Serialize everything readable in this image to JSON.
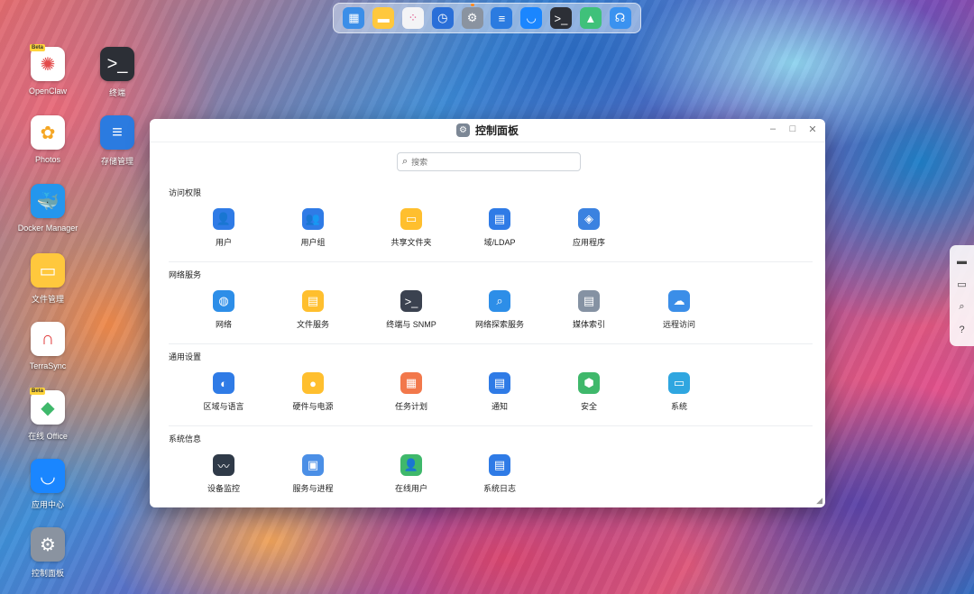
{
  "dock": {
    "items": [
      {
        "name": "dock-app-layout-icon",
        "glyph": "▦",
        "color": "#3b8ee8"
      },
      {
        "name": "dock-notes-icon",
        "glyph": "▬",
        "color": "#ffc83d"
      },
      {
        "name": "dock-app-grid-icon",
        "glyph": "⁘",
        "color": "#f4f4f6"
      },
      {
        "name": "dock-backup-icon",
        "glyph": "◷",
        "color": "#2a6fd8"
      },
      {
        "name": "dock-settings-icon",
        "glyph": "⚙",
        "color": "#8a93a0"
      },
      {
        "name": "dock-storage-icon",
        "glyph": "≡",
        "color": "#2b7be0"
      },
      {
        "name": "dock-app-center-icon",
        "glyph": "◡",
        "color": "#1a86ff"
      },
      {
        "name": "dock-terminal-icon",
        "glyph": ">_",
        "color": "#2c2f36"
      },
      {
        "name": "dock-photos-tree-icon",
        "glyph": "▲",
        "color": "#3fc17a"
      },
      {
        "name": "dock-support-icon",
        "glyph": "☊",
        "color": "#3a92f0"
      }
    ]
  },
  "desktop": {
    "icons": [
      {
        "id": "openclaw",
        "label": "OpenClaw",
        "glyph": "✺",
        "color": "#e34a4a",
        "bg": "#ffffff",
        "beta": "Beta"
      },
      {
        "id": "terminal",
        "label": "终端",
        "glyph": ">_",
        "color": "#ffffff",
        "bg": "#2c2f36",
        "beta": ""
      },
      {
        "id": "photos",
        "label": "Photos",
        "glyph": "✿",
        "color": "#f5a623",
        "bg": "#ffffff",
        "beta": ""
      },
      {
        "id": "storage",
        "label": "存储管理",
        "glyph": "≡",
        "color": "#ffffff",
        "bg": "#2b7be0",
        "beta": ""
      },
      {
        "id": "docker",
        "label": "Docker Manager",
        "glyph": "🐳",
        "color": "#ffffff",
        "bg": "#2496ed",
        "beta": ""
      },
      {
        "id": "files",
        "label": "文件管理",
        "glyph": "▭",
        "color": "#ffffff",
        "bg": "#ffc83d",
        "beta": ""
      },
      {
        "id": "terrasync",
        "label": "TerraSync",
        "glyph": "∩",
        "color": "#e03b3b",
        "bg": "#ffffff",
        "beta": ""
      },
      {
        "id": "office",
        "label": "在线 Office",
        "glyph": "◆",
        "color": "#3fb86b",
        "bg": "#ffffff",
        "beta": "Beta"
      },
      {
        "id": "appcenter",
        "label": "应用中心",
        "glyph": "◡",
        "color": "#ffffff",
        "bg": "#1a86ff",
        "beta": ""
      },
      {
        "id": "controlpanel",
        "label": "控制面板",
        "glyph": "⚙",
        "color": "#ffffff",
        "bg": "#8a93a0",
        "beta": ""
      }
    ]
  },
  "window": {
    "title": "控制面板",
    "controls": {
      "minimize": "–",
      "maximize": "□",
      "close": "✕"
    },
    "search": {
      "placeholder": "搜索",
      "value": ""
    }
  },
  "sections": [
    {
      "title": "访问权限",
      "items": [
        {
          "label": "用户",
          "icon": "user-icon",
          "glyph": "👤",
          "color": "#2f7be6"
        },
        {
          "label": "用户组",
          "icon": "user-group-icon",
          "glyph": "👥",
          "color": "#2f7be6"
        },
        {
          "label": "共享文件夹",
          "icon": "shared-folder-icon",
          "glyph": "▭",
          "color": "#ffbf2e"
        },
        {
          "label": "域/LDAP",
          "icon": "domain-ldap-icon",
          "glyph": "▤",
          "color": "#2f7be6"
        },
        {
          "label": "应用程序",
          "icon": "application-icon",
          "glyph": "◈",
          "color": "#3b82e0"
        }
      ]
    },
    {
      "title": "网络服务",
      "items": [
        {
          "label": "网络",
          "icon": "network-globe-icon",
          "glyph": "◍",
          "color": "#2d8ee8"
        },
        {
          "label": "文件服务",
          "icon": "file-service-icon",
          "glyph": "▤",
          "color": "#ffbf2e"
        },
        {
          "label": "终端与 SNMP",
          "icon": "terminal-snmp-icon",
          "glyph": ">_",
          "color": "#3b4250"
        },
        {
          "label": "网络探索服务",
          "icon": "network-discovery-icon",
          "glyph": "⌕",
          "color": "#2d8ee8"
        },
        {
          "label": "媒体索引",
          "icon": "media-index-icon",
          "glyph": "▤",
          "color": "#8592a3"
        },
        {
          "label": "远程访问",
          "icon": "remote-access-cloud-icon",
          "glyph": "☁",
          "color": "#3b8ee8"
        }
      ]
    },
    {
      "title": "通用设置",
      "items": [
        {
          "label": "区域与语言",
          "icon": "region-language-icon",
          "glyph": "◐",
          "color": "#2f7be6"
        },
        {
          "label": "硬件与电源",
          "icon": "hardware-power-bulb-icon",
          "glyph": "●",
          "color": "#ffbf2e"
        },
        {
          "label": "任务计划",
          "icon": "task-schedule-calendar-icon",
          "glyph": "▦",
          "color": "#f2784b"
        },
        {
          "label": "通知",
          "icon": "notification-icon",
          "glyph": "▤",
          "color": "#2f7be6"
        },
        {
          "label": "安全",
          "icon": "security-shield-icon",
          "glyph": "⬢",
          "color": "#3fb86b"
        },
        {
          "label": "系统",
          "icon": "system-monitor-icon",
          "glyph": "▭",
          "color": "#2fa6e0"
        }
      ]
    },
    {
      "title": "系统信息",
      "items": [
        {
          "label": "设备监控",
          "icon": "device-monitor-icon",
          "glyph": "〰",
          "color": "#2f3a48"
        },
        {
          "label": "服务与进程",
          "icon": "service-process-icon",
          "glyph": "▣",
          "color": "#4b8fe6"
        },
        {
          "label": "在线用户",
          "icon": "online-user-icon",
          "glyph": "👤",
          "color": "#3fb86b"
        },
        {
          "label": "系统日志",
          "icon": "system-log-icon",
          "glyph": "▤",
          "color": "#2f7be6"
        }
      ]
    }
  ],
  "right_toolbar": [
    {
      "name": "message-icon",
      "glyph": "▬"
    },
    {
      "name": "chat-icon",
      "glyph": "▭"
    },
    {
      "name": "search-icon",
      "glyph": "⌕"
    },
    {
      "name": "help-icon",
      "glyph": "?"
    }
  ]
}
